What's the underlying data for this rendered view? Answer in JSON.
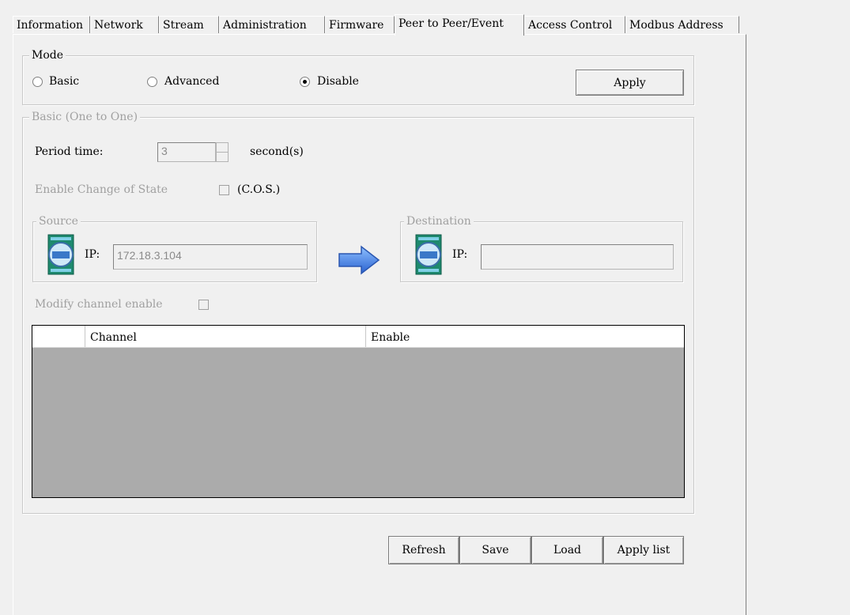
{
  "tabs": [
    "Information",
    "Network",
    "Stream",
    "Administration",
    "Firmware",
    "Peer to Peer/Event",
    "Access Control",
    "Modbus Address"
  ],
  "active_tab": "Peer to Peer/Event",
  "mode": {
    "legend": "Mode",
    "options": [
      "Basic",
      "Advanced",
      "Disable"
    ],
    "selected": "Disable",
    "apply_label": "Apply"
  },
  "basic": {
    "legend": "Basic (One to One)",
    "period_label": "Period time:",
    "period_value": "3",
    "period_unit": "second(s)",
    "cos_label": "Enable Change of State",
    "cos_suffix": "(C.O.S.)",
    "source": {
      "legend": "Source",
      "ip_label": "IP:",
      "ip_value": "172.18.3.104"
    },
    "destination": {
      "legend": "Destination",
      "ip_label": "IP:",
      "ip_value": ""
    },
    "modify_label": "Modify channel enable",
    "table": {
      "columns": [
        "",
        "Channel",
        "Enable"
      ],
      "rows": []
    }
  },
  "footer": {
    "refresh": "Refresh",
    "save": "Save",
    "load": "Load",
    "apply_list": "Apply list"
  },
  "colors": {
    "panel": "#f0f0f0",
    "table_bg": "#ababab",
    "arrow": "#3a78d8"
  }
}
